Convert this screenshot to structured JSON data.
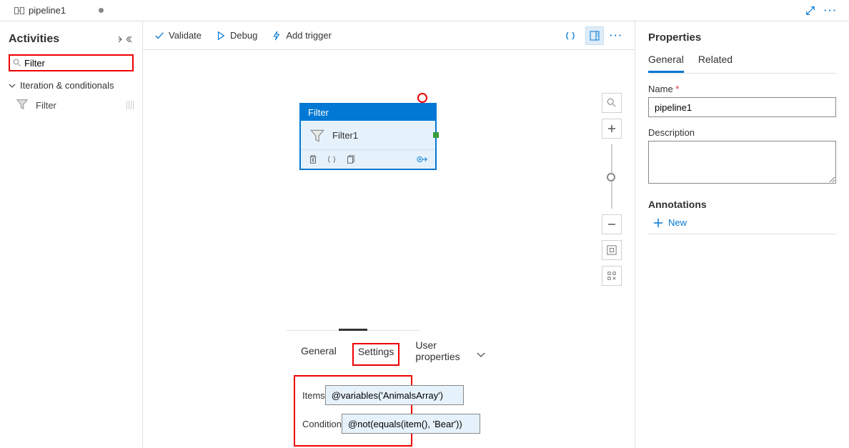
{
  "tab": {
    "title": "pipeline1"
  },
  "activities": {
    "title": "Activities",
    "search": "Filter",
    "category": "Iteration & conditionals",
    "item": "Filter"
  },
  "toolbar": {
    "validate": "Validate",
    "debug": "Debug",
    "add_trigger": "Add trigger"
  },
  "node": {
    "type": "Filter",
    "name": "Filter1"
  },
  "bottom": {
    "tabs": {
      "general": "General",
      "settings": "Settings",
      "user_props": "User properties"
    },
    "items_label": "Items",
    "items_value": "@variables('AnimalsArray')",
    "condition_label": "Condition",
    "condition_value": "@not(equals(item(), 'Bear'))"
  },
  "properties": {
    "title": "Properties",
    "tabs": {
      "general": "General",
      "related": "Related"
    },
    "name_label": "Name",
    "name_value": "pipeline1",
    "description_label": "Description",
    "description_value": "",
    "annotations_label": "Annotations",
    "new_label": "New"
  }
}
